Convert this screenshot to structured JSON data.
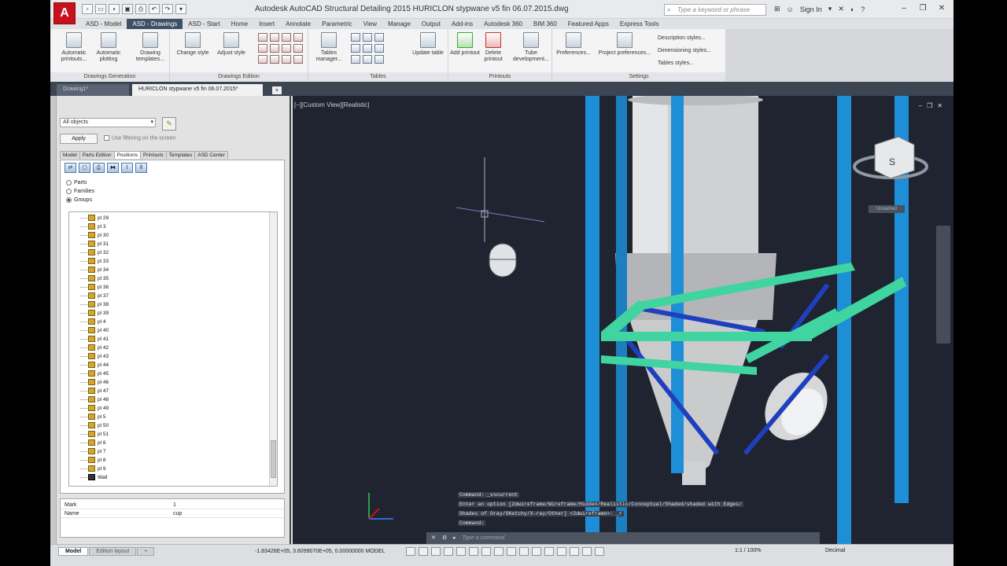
{
  "titlebar": {
    "app_logo": "A",
    "title": "Autodesk AutoCAD Structural Detailing 2015      HURICLON stypwane v5  fin 06.07.2015.dwg",
    "search_placeholder": "Type a keyword or phrase",
    "sign_in": "Sign In"
  },
  "ribbon_tabs": [
    "ASD - Model",
    "ASD - Drawings",
    "ASD - Start",
    "Home",
    "Insert",
    "Annotate",
    "Parametric",
    "View",
    "Manage",
    "Output",
    "Add-ins",
    "Autodesk 360",
    "BIM 360",
    "Featured Apps",
    "Express Tools"
  ],
  "ribbon": {
    "groups": {
      "generation": {
        "label": "Drawings Generation",
        "btn1": "Automatic printouts...",
        "btn2": "Automatic plotting",
        "btn3": "Drawing templates..."
      },
      "edition": {
        "label": "Drawings Edition",
        "btn1": "Change style",
        "btn2": "Adjust style"
      },
      "tables": {
        "label": "Tables",
        "btn1": "Tables manager...",
        "btn2": "Update table"
      },
      "printouts": {
        "label": "Printouts",
        "btn1": "Add printout",
        "btn2": "Delete printout",
        "btn3": "Tube development..."
      },
      "settings": {
        "label": "Settings",
        "btn1": "Preferences...",
        "btn2": "Project preferences...",
        "item1": "Description styles...",
        "item2": "Dimensioning styles...",
        "item3": "Tables styles..."
      }
    }
  },
  "doc_tabs": {
    "inactive": "Drawing1*",
    "active": "HURICLON stypwane v5  fin 06.07.2015*"
  },
  "palette": {
    "select_value": "All objects",
    "apply": "Apply",
    "use_filtering": "Use filtering on the screen",
    "tabs": [
      "Model",
      "Parts Edition",
      "Positions",
      "Printouts",
      "Templates",
      "ASD Center"
    ],
    "radios": [
      "Parts",
      "Families",
      "Groups"
    ],
    "tree_items": [
      "pl 29",
      "pl 3",
      "pl 30",
      "pl 31",
      "pl 32",
      "pl 33",
      "pl 34",
      "pl 35",
      "pl 36",
      "pl 37",
      "pl 38",
      "pl 39",
      "pl 4",
      "pl 40",
      "pl 41",
      "pl 42",
      "pl 43",
      "pl 44",
      "pl 45",
      "pl 46",
      "pl 47",
      "pl 48",
      "pl 49",
      "pl 5",
      "pl 50",
      "pl 51",
      "pl 6",
      "pl 7",
      "pl 8",
      "pl 9",
      "Wall"
    ],
    "properties": [
      {
        "key": "Mark",
        "value": "1"
      },
      {
        "key": "Name",
        "value": "cup"
      }
    ]
  },
  "viewport": {
    "label": "[−][Custom View][Realistic]",
    "unnamed": "Unnamed",
    "viewcube_face": "S",
    "cmd_history": [
      "Command: _vscurrent",
      "Enter an option [2dwireframe/Wireframe/Hidden/Realistic/Conceptual/Shaded/shaded with Edges/",
      "Shades of Gray/SKetchy/X-ray/Other] <2dwireframe>: _r",
      "Command:"
    ],
    "cmd_placeholder": "Type a command"
  },
  "status": {
    "tabs": [
      "Model",
      "Edition layout"
    ],
    "coords": "-1.83426E+05, 3.6099070E+05, 0.00000000   MODEL",
    "scale": "1:1 / 100%",
    "units": "Decimal"
  },
  "colors": {
    "viewport_bg": "#1f2430",
    "column_blue": "#1e8fd6",
    "frame_green": "#3fd4a0",
    "brace_blue": "#1f3fbf",
    "autocad_red": "#c8101c"
  }
}
